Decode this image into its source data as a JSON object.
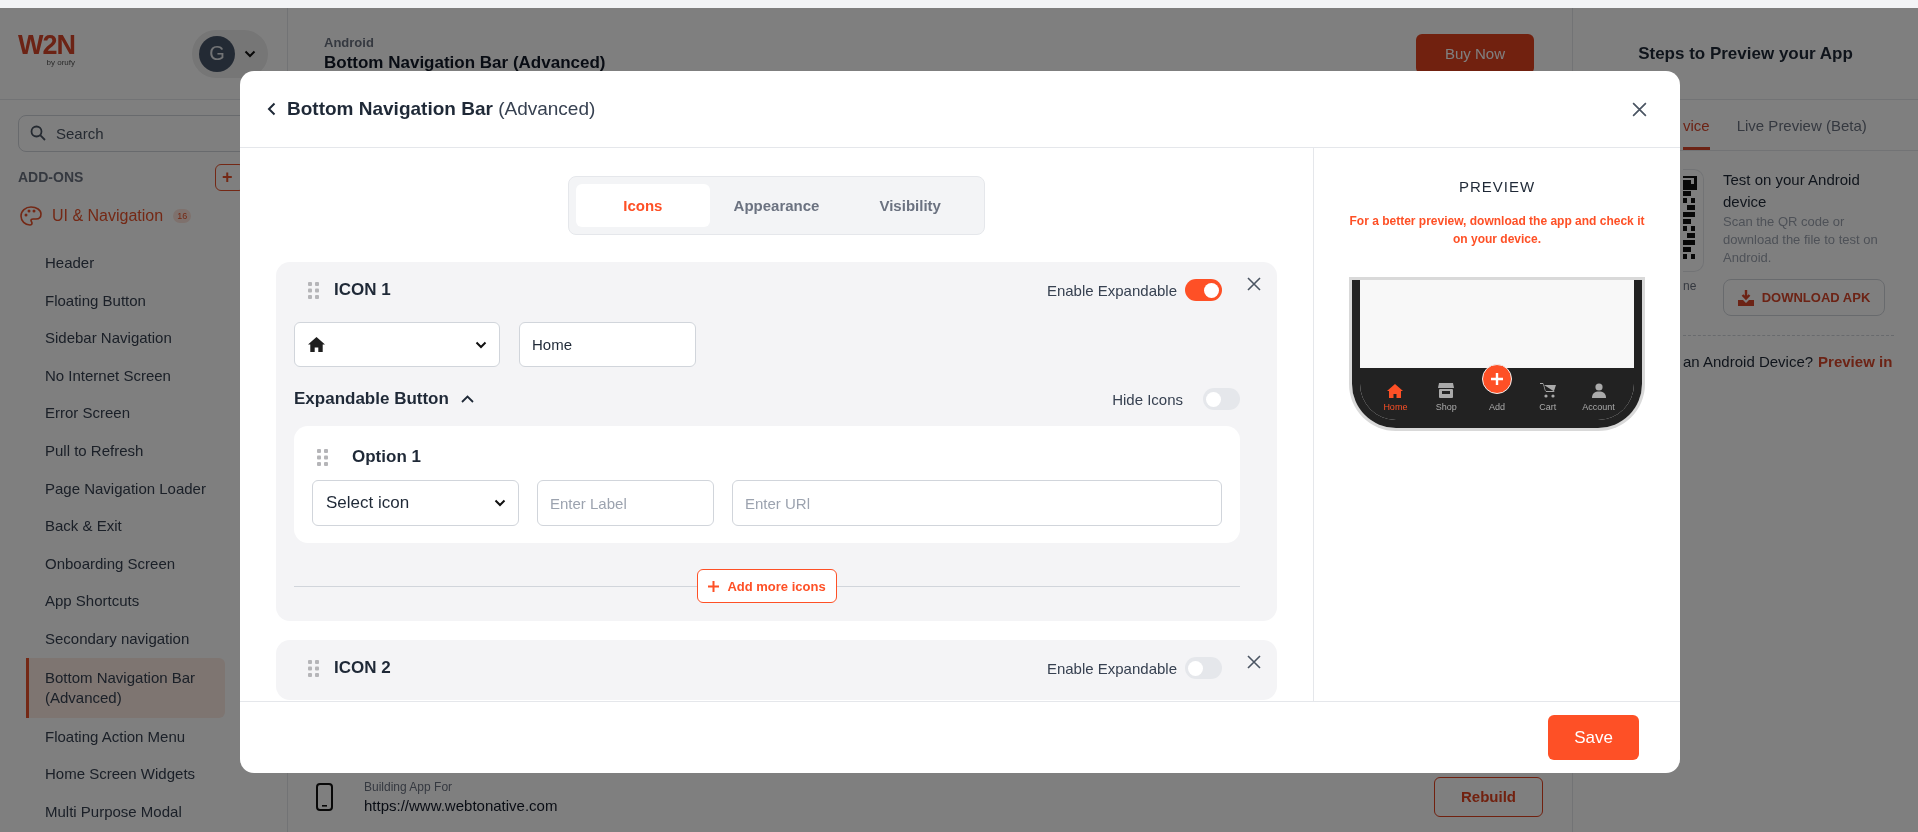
{
  "sidebar": {
    "logo": "W2N",
    "logo_tagline": "by orufy",
    "avatar_initial": "G",
    "search": {
      "placeholder": "Search"
    },
    "section_title": "ADD-ONS",
    "add_button": "+",
    "category": {
      "label": "UI & Navigation",
      "count": "16"
    },
    "items": [
      {
        "label": "Header",
        "selected": false
      },
      {
        "label": "Floating Button",
        "selected": false
      },
      {
        "label": "Sidebar Navigation",
        "selected": false
      },
      {
        "label": "No Internet Screen",
        "selected": false
      },
      {
        "label": "Error Screen",
        "selected": false
      },
      {
        "label": "Pull to Refresh",
        "selected": false
      },
      {
        "label": "Page Navigation Loader",
        "selected": false
      },
      {
        "label": "Back & Exit",
        "selected": false
      },
      {
        "label": "Onboarding Screen",
        "selected": false
      },
      {
        "label": "App Shortcuts",
        "selected": false
      },
      {
        "label": "Secondary navigation",
        "selected": false
      },
      {
        "label": "Bottom Navigation Bar (Advanced)",
        "selected": true
      },
      {
        "label": "Floating Action Menu",
        "selected": false
      },
      {
        "label": "Home Screen Widgets",
        "selected": false
      },
      {
        "label": "Multi Purpose Modal",
        "selected": false
      }
    ]
  },
  "header": {
    "platform": "Android",
    "title": "Bottom Navigation Bar (Advanced)",
    "buy_button": "Buy Now"
  },
  "build_bar": {
    "caption": "Building App For",
    "url": "https://www.webtonative.com",
    "rebuild_button": "Rebuild"
  },
  "steps_panel": {
    "title": "Steps to Preview your App",
    "tabs": [
      {
        "label": "vice",
        "selected": true
      },
      {
        "label": "Live Preview (Beta)",
        "selected": false
      }
    ],
    "qr_caption": "ne",
    "test_title": "Test on your Android device",
    "test_text": "Scan the QR code or download the file to test on Android.",
    "download_button": "DOWNLOAD APK",
    "no_device_text": "an Android Device?",
    "preview_link": "Preview in"
  },
  "modal": {
    "title": "**Bottom Navigation Bar** (Advanced)",
    "tabs": [
      {
        "label": "Icons",
        "selected": true
      },
      {
        "label": "Appearance",
        "selected": false
      },
      {
        "label": "Visibility",
        "selected": false
      }
    ],
    "icons": [
      {
        "title": "ICON 1",
        "expandable_label": "Enable Expandable",
        "expandable": true,
        "label_value": "Home",
        "section_title": "Expandable Button",
        "section_expanded": true,
        "hide_icons_label": "Hide Icons",
        "hide_icons": false,
        "options": [
          {
            "title": "Option 1",
            "icon_value": "Select icon",
            "label_placeholder": "Enter Label",
            "url_placeholder": "Enter URl"
          }
        ],
        "add_button": "Add more icons"
      },
      {
        "title": "ICON 2",
        "expandable_label": "Enable Expandable",
        "expandable": false
      }
    ],
    "preview": {
      "title": "PREVIEW",
      "note": "For a better preview, download the app and check it on your device.",
      "nav_items": [
        {
          "label": "Home",
          "kind": "home",
          "selected": true
        },
        {
          "label": "Shop",
          "kind": "shop",
          "selected": false
        },
        {
          "label": "Add",
          "kind": "add",
          "selected": false
        },
        {
          "label": "Cart",
          "kind": "cart",
          "selected": false
        },
        {
          "label": "Account",
          "kind": "account",
          "selected": false
        }
      ]
    },
    "save_button": "Save"
  }
}
